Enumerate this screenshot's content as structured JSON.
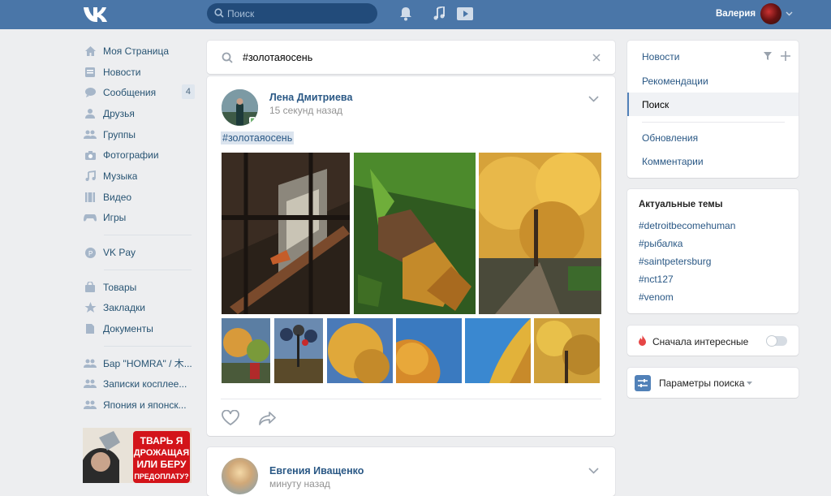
{
  "header": {
    "logo": "vk-logo",
    "search_placeholder": "Поиск",
    "user_name": "Валерия"
  },
  "sidebar": {
    "items": [
      {
        "label": "Моя Страница",
        "icon": "home-icon"
      },
      {
        "label": "Новости",
        "icon": "news-icon"
      },
      {
        "label": "Сообщения",
        "icon": "messages-icon",
        "badge": "4"
      },
      {
        "label": "Друзья",
        "icon": "friends-icon"
      },
      {
        "label": "Группы",
        "icon": "groups-icon"
      },
      {
        "label": "Фотографии",
        "icon": "camera-icon"
      },
      {
        "label": "Музыка",
        "icon": "music-icon"
      },
      {
        "label": "Видео",
        "icon": "video-icon"
      },
      {
        "label": "Игры",
        "icon": "games-icon"
      }
    ],
    "pay": {
      "label": "VK Pay",
      "icon": "vkpay-icon"
    },
    "extra": [
      {
        "label": "Товары",
        "icon": "bag-icon"
      },
      {
        "label": "Закладки",
        "icon": "star-icon"
      },
      {
        "label": "Документы",
        "icon": "document-icon"
      }
    ],
    "communities": [
      {
        "label": "Бар \"HOMRA\" / 木..."
      },
      {
        "label": "Записки косплее..."
      },
      {
        "label": "Япония и японск..."
      }
    ],
    "ad_text": "ТВАРЬ Я ДРОЖАЩАЯ ИЛИ БЕРУ ПРЕДОПЛАТУ?"
  },
  "feed": {
    "query": "#золотаяосень",
    "post": {
      "author": "Лена Дмитриева",
      "time": "15 секунд назад",
      "hashtag": "#золотаяосень"
    },
    "post2": {
      "author": "Евгения Иващенко",
      "time": "минуту назад"
    }
  },
  "right_menu": {
    "items": [
      "Новости",
      "Рекомендации",
      "Поиск",
      "Обновления",
      "Комментарии"
    ],
    "active": "Поиск"
  },
  "topics": {
    "title": "Актуальные темы",
    "items": [
      "#detroitbecomehuman",
      "#рыбалка",
      "#saintpetersburg",
      "#nct127",
      "#venom"
    ]
  },
  "interest": {
    "label": "Сначала интересные",
    "enabled": false
  },
  "params": {
    "label": "Параметры поиска"
  },
  "colors": {
    "header": "#4a76a8",
    "link": "#2a5885",
    "background": "#edeef0"
  }
}
